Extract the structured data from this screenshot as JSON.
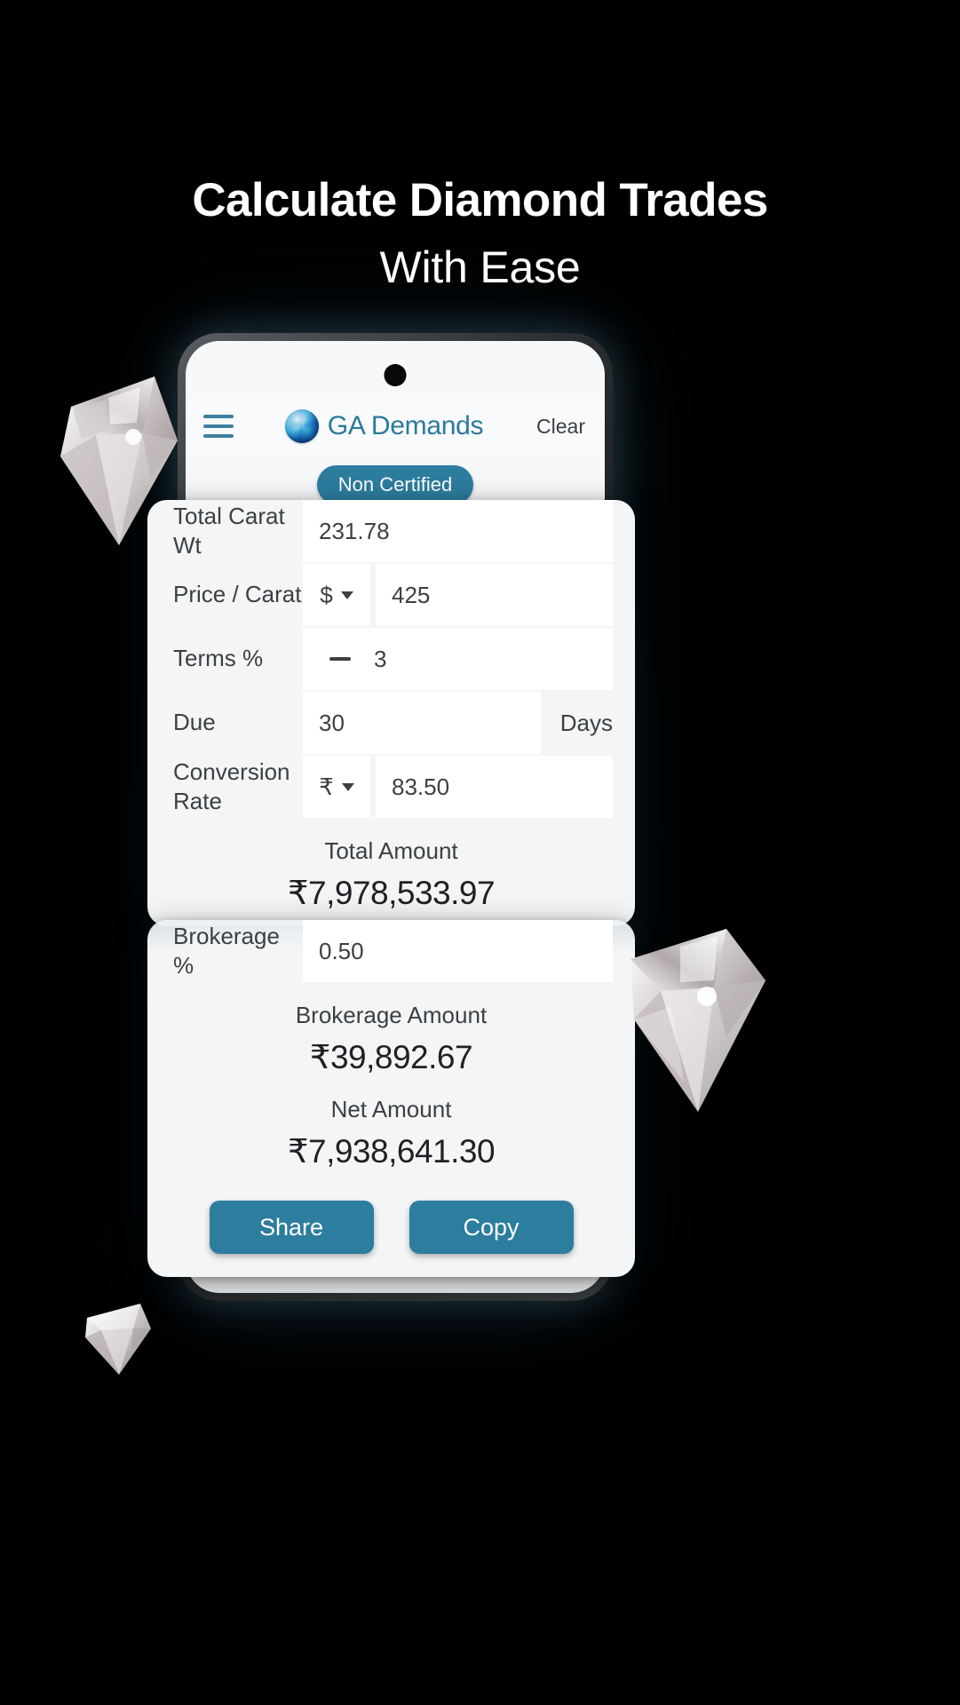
{
  "promo": {
    "headline": "Calculate Diamond Trades",
    "subheadline": "With Ease",
    "background_color": "#000000",
    "text_color": "#ffffff"
  },
  "app": {
    "brand_name": "GA Demands",
    "brand_color": "#2b7a9c",
    "accent_color": "#2d7d9f",
    "menu_icon": "hamburger-icon",
    "logo_icon": "diamond-globe-logo",
    "clear_label": "Clear",
    "mode_chip": "Non Certified"
  },
  "form": {
    "rows": [
      {
        "label": "Total Carat Wt",
        "value": "231.78",
        "unit": null,
        "suffix": null,
        "prefix_icon": null
      },
      {
        "label": "Price / Carat",
        "value": "425",
        "unit": "$",
        "suffix": null,
        "prefix_icon": null
      },
      {
        "label": "Terms %",
        "value": "3",
        "unit": null,
        "suffix": null,
        "prefix_icon": "minus-sign"
      },
      {
        "label": "Due",
        "value": "30",
        "unit": null,
        "suffix": "Days",
        "prefix_icon": null
      },
      {
        "label": "Conversion Rate",
        "value": "83.50",
        "unit": "₹",
        "suffix": null,
        "prefix_icon": null
      }
    ]
  },
  "totals": {
    "total_amount_label": "Total Amount",
    "total_amount_value": "₹7,978,533.97",
    "obscured_label": "Brokerage Amount"
  },
  "brokerage": {
    "percent_label": "Brokerage %",
    "percent_value": "0.50",
    "amount_label": "Brokerage Amount",
    "amount_value": "₹39,892.67",
    "net_label": "Net Amount",
    "net_value": "₹7,938,641.30"
  },
  "actions": {
    "share_label": "Share",
    "copy_label": "Copy"
  },
  "decorations": {
    "diamond_large_left": "diamond-icon",
    "diamond_large_right": "diamond-icon",
    "diamond_small_bottom": "diamond-icon"
  }
}
